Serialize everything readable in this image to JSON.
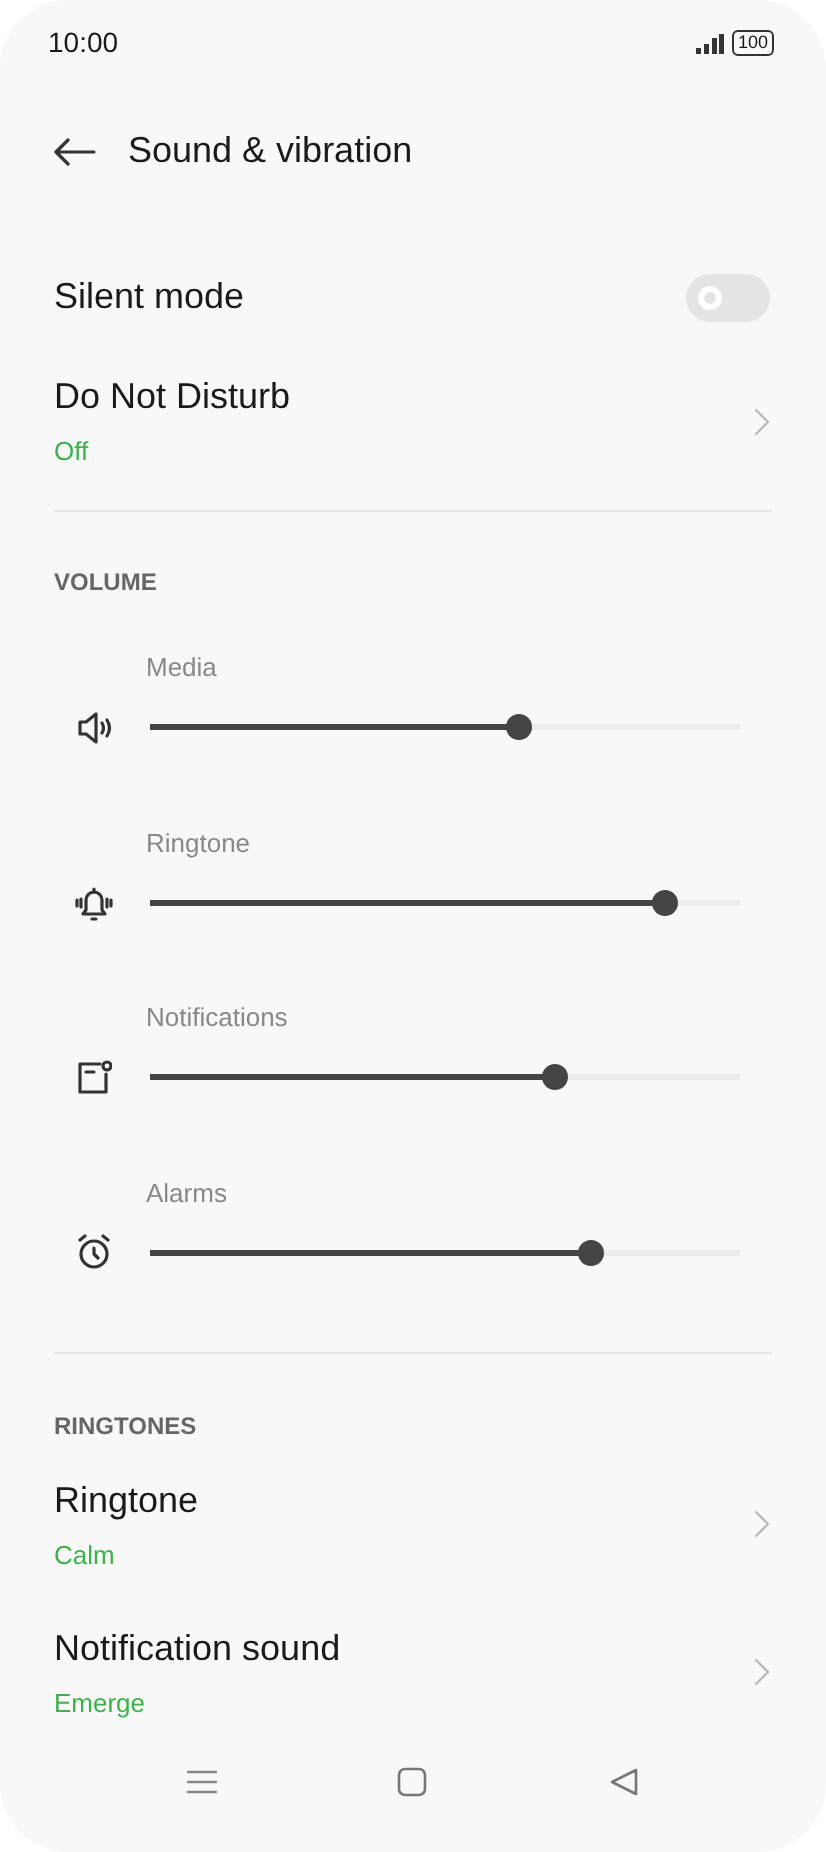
{
  "status_bar": {
    "time": "10:00",
    "battery": "100"
  },
  "header": {
    "title": "Sound & vibration"
  },
  "top_items": [
    {
      "kind": "toggle",
      "label": "Silent mode",
      "on": false
    },
    {
      "kind": "link",
      "label": "Do Not Disturb",
      "value": "Off"
    }
  ],
  "volume": {
    "heading": "VOLUME",
    "sliders": [
      {
        "kind": "media",
        "label": "Media",
        "level": 0.626
      },
      {
        "kind": "ringtone",
        "label": "Ringtone",
        "level": 0.874
      },
      {
        "kind": "notifications",
        "label": "Notifications",
        "level": 0.687
      },
      {
        "kind": "alarms",
        "label": "Alarms",
        "level": 0.748
      }
    ]
  },
  "ringtones": {
    "heading": "RINGTONES",
    "items": [
      {
        "kind": "link",
        "label": "Ringtone",
        "value": "Calm"
      },
      {
        "kind": "link",
        "label": "Notification sound",
        "value": "Emerge"
      }
    ]
  }
}
